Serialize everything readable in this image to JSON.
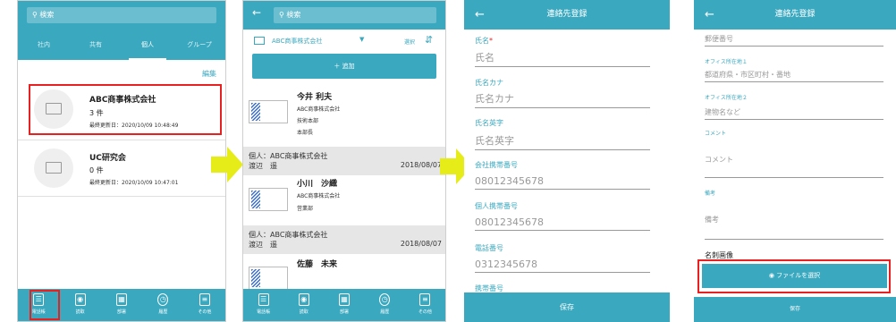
{
  "screen1": {
    "search_placeholder": "検索",
    "tabs": [
      "社内",
      "共有",
      "個人",
      "グループ"
    ],
    "edit_label": "編集",
    "items": [
      {
        "title": "ABC商事株式会社",
        "count": "3 件",
        "updated": "最終更新日：2020/10/09 10:48:49"
      },
      {
        "title": "UC研究会",
        "count": "0 件",
        "updated": "最終更新日：2020/10/09 10:47:01"
      }
    ],
    "nav": [
      "電話帳",
      "読取",
      "部署",
      "履歴",
      "その他"
    ]
  },
  "screen2": {
    "search_placeholder": "検索",
    "folder_name": "ABC商事株式会社",
    "select_label": "選択",
    "add_label": "＋ 追加",
    "contacts": [
      {
        "name": "今井 利夫",
        "company": "ABC商事株式会社",
        "dept": "技術本部",
        "title": "本部長"
      },
      {
        "name": "小川　沙織",
        "company": "ABC商事株式会社",
        "dept": "営業部"
      },
      {
        "name": "佐藤　未来"
      }
    ],
    "groups": [
      {
        "label": "個人：ABC商事株式会社",
        "person": "渡辺　遥",
        "date": "2018/08/07"
      },
      {
        "label": "個人：ABC商事株式会社",
        "person": "渡辺　遥",
        "date": "2018/08/07"
      }
    ],
    "nav": [
      "電話帳",
      "読取",
      "部署",
      "履歴",
      "その他"
    ]
  },
  "screen3": {
    "title": "連絡先登録",
    "fields": [
      {
        "label": "氏名",
        "placeholder": "氏名"
      },
      {
        "label": "氏名カナ",
        "placeholder": "氏名カナ"
      },
      {
        "label": "氏名英字",
        "placeholder": "氏名英字"
      },
      {
        "label": "会社携帯番号",
        "placeholder": "08012345678"
      },
      {
        "label": "個人携帯番号",
        "placeholder": "08012345678"
      },
      {
        "label": "電話番号",
        "placeholder": "0312345678"
      },
      {
        "label": "携帯番号",
        "placeholder": ""
      }
    ],
    "required_mark": "*",
    "save_label": "保存"
  },
  "screen4": {
    "title": "連絡先登録",
    "postal_placeholder": "郵便番号",
    "addr1_label": "オフィス所在地１",
    "addr1_placeholder": "都道府県・市区町村・番地",
    "addr2_label": "オフィス所在地２",
    "addr2_placeholder": "建物名など",
    "comment_label": "コメント",
    "comment_placeholder": "コメント",
    "note_label": "備考",
    "note_placeholder": "備考",
    "image_label": "名刺画像",
    "file_button": "ファイルを選択",
    "save_label": "保存"
  },
  "colors": {
    "accent": "#3aa8bf",
    "highlight": "#e8201f",
    "arrow": "#e6ec17"
  }
}
